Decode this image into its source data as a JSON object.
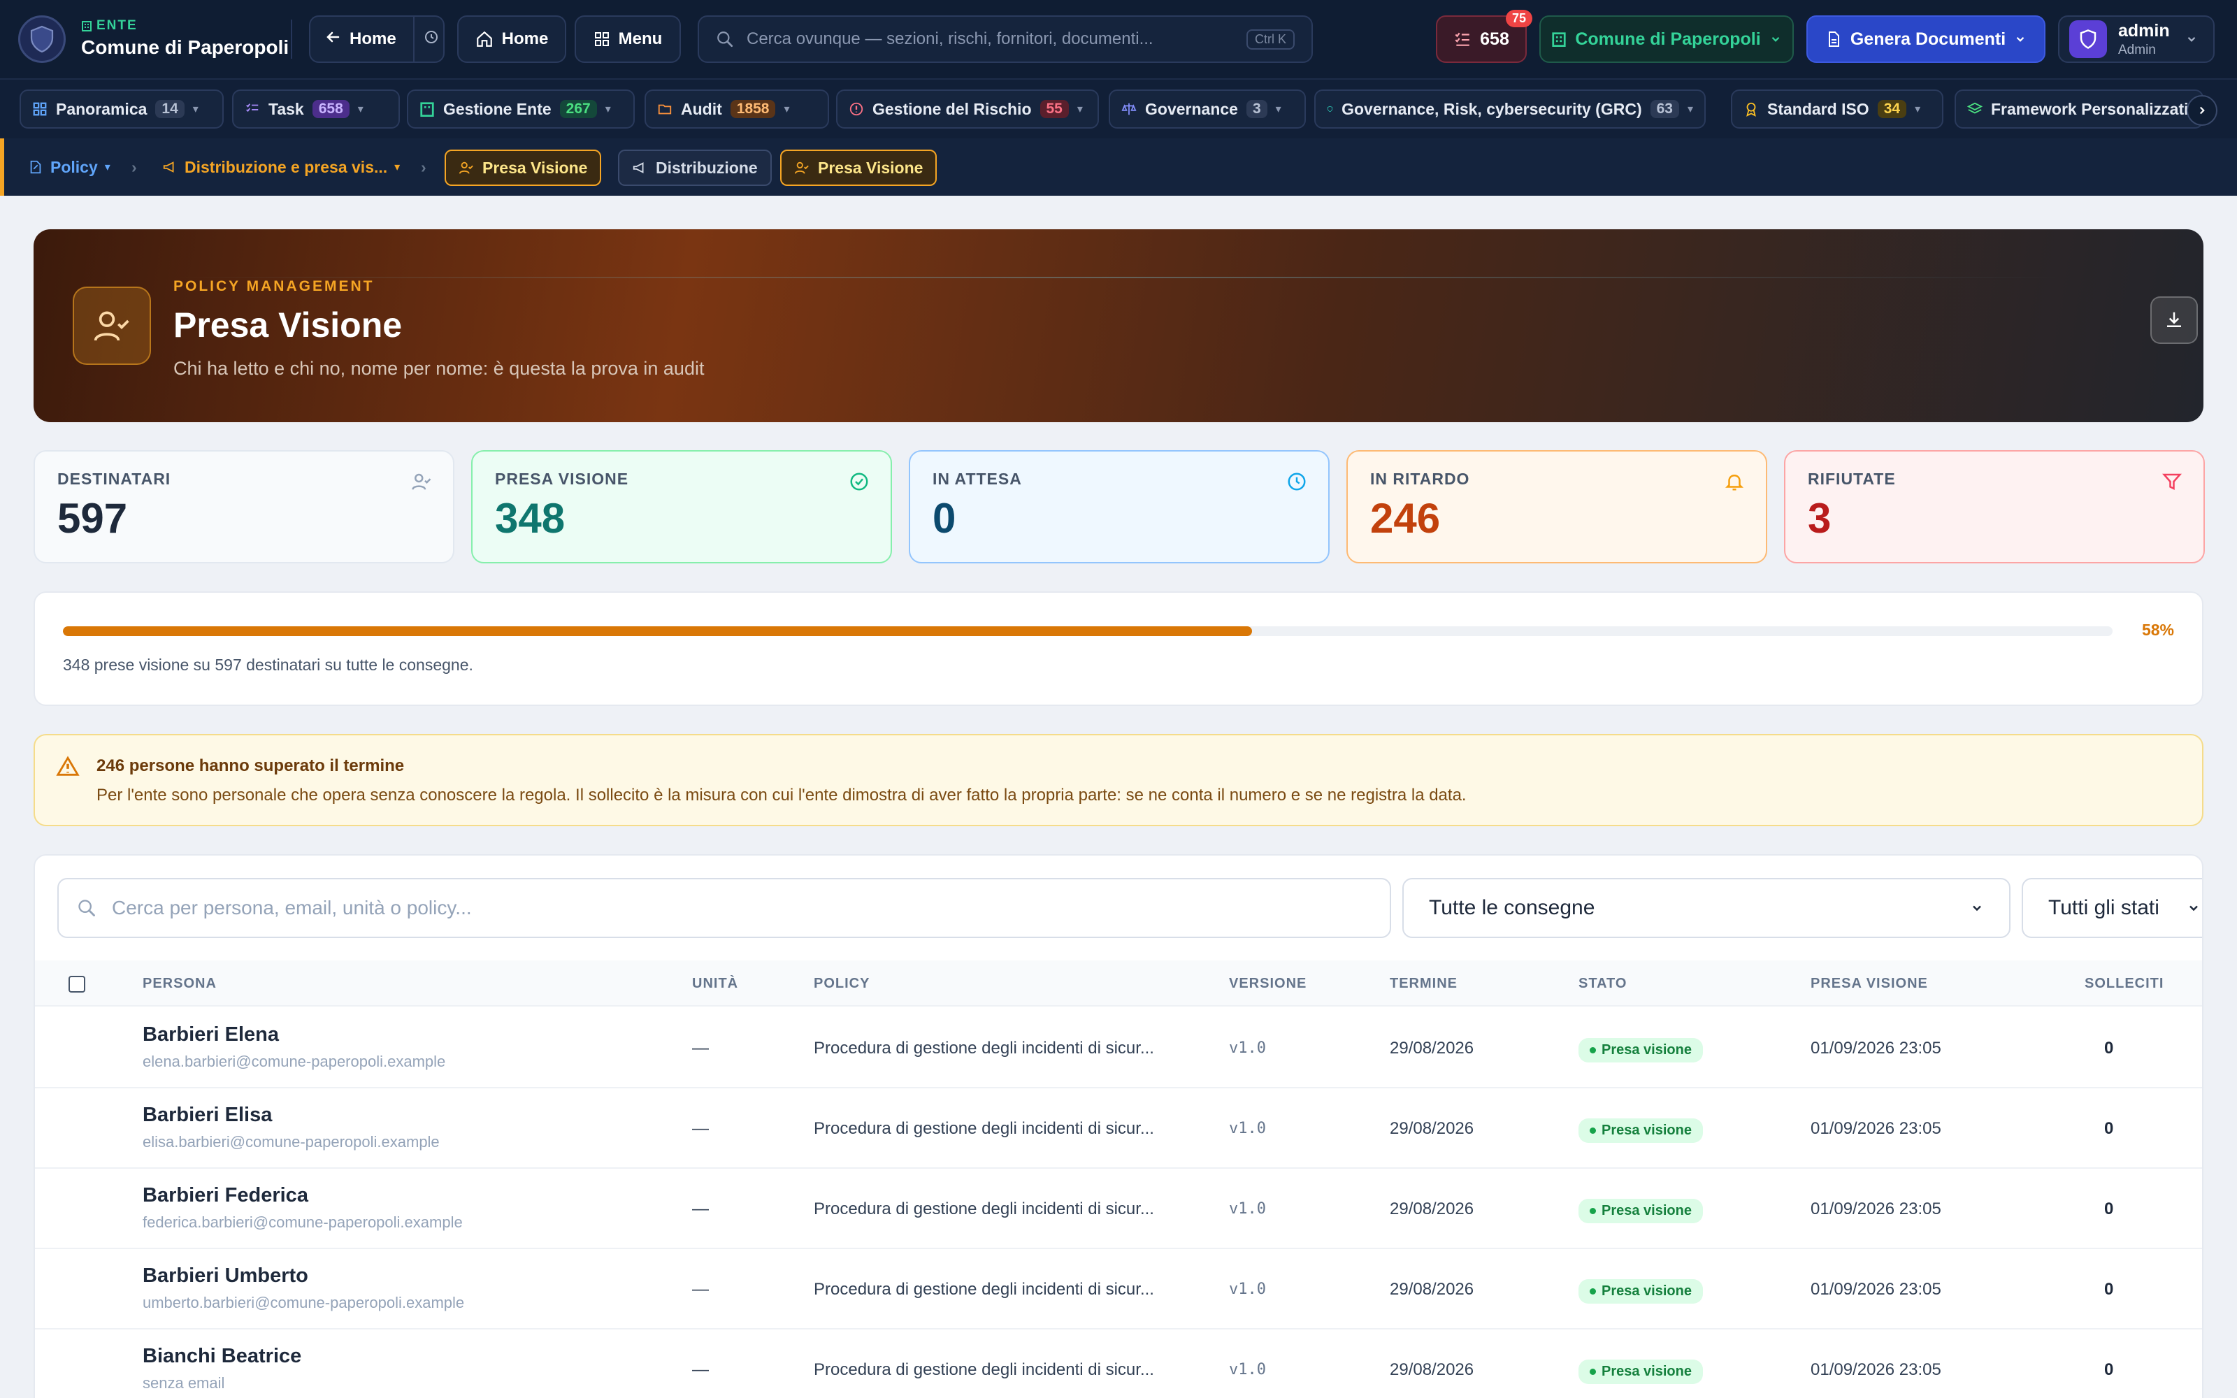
{
  "header": {
    "ente_tag": "ENTE",
    "ente_name": "Comune di Paperopoli",
    "back_label": "Home",
    "home_label": "Home",
    "menu_label": "Menu",
    "search_placeholder": "Cerca ovunque — sezioni, rischi, fornitori, documenti...",
    "search_shortcut": "Ctrl K",
    "tasks_count": "658",
    "notifications_count": "75",
    "org_label": "Comune di Paperopoli",
    "generate_label": "Genera Documenti",
    "user_name": "admin",
    "user_role": "Admin"
  },
  "modules": [
    {
      "label": "Panoramica",
      "count": "14",
      "icon": "grid-icon"
    },
    {
      "label": "Task",
      "count": "658",
      "icon": "checklist-icon"
    },
    {
      "label": "Gestione Ente",
      "count": "267",
      "icon": "building-icon"
    },
    {
      "label": "Audit",
      "count": "1858",
      "icon": "folder-icon"
    },
    {
      "label": "Gestione del Rischio",
      "count": "55",
      "icon": "alert-circle-icon"
    },
    {
      "label": "Governance",
      "count": "3",
      "icon": "scale-icon"
    },
    {
      "label": "Governance, Risk, cybersecurity (GRC)",
      "count": "63",
      "icon": "shield-icon"
    },
    {
      "label": "Standard ISO",
      "count": "34",
      "icon": "award-icon"
    },
    {
      "label": "Framework Personalizzati",
      "count": "",
      "icon": "layers-icon"
    }
  ],
  "breadcrumb": {
    "root": "Policy",
    "section": "Distribuzione e presa vis...",
    "current": "Presa Visione",
    "tabs": [
      "Distribuzione",
      "Presa Visione"
    ]
  },
  "hero": {
    "kicker": "POLICY MANAGEMENT",
    "title": "Presa Visione",
    "subtitle": "Chi ha letto e chi no, nome per nome: è questa la prova in audit"
  },
  "stats": [
    {
      "label": "DESTINATARI",
      "value": "597",
      "color": "#1e293b",
      "icon": "user-check-icon"
    },
    {
      "label": "PRESA VISIONE",
      "value": "348",
      "color": "#0f766e",
      "icon": "check-circle-icon"
    },
    {
      "label": "IN ATTESA",
      "value": "0",
      "color": "#0c4a6e",
      "icon": "clock-icon"
    },
    {
      "label": "IN RITARDO",
      "value": "246",
      "color": "#c2410c",
      "icon": "bell-icon"
    },
    {
      "label": "RIFIUTATE",
      "value": "3",
      "color": "#b91c1c",
      "icon": "filter-icon"
    }
  ],
  "progress": {
    "fraction": 0.58,
    "percent_label": "58%",
    "caption": "348 prese visione su 597 destinatari su tutte le consegne."
  },
  "warning": {
    "title": "246 persone hanno superato il termine",
    "text": "Per l'ente sono personale che opera senza conoscere la regola. Il sollecito è la misura con cui l'ente dimostra di aver fatto la propria parte: se ne conta il numero e se ne registra la data."
  },
  "filters": {
    "search_placeholder": "Cerca per persona, email, unità o policy...",
    "delivery_select": "Tutte le consegne",
    "status_select": "Tutti gli stati"
  },
  "table": {
    "columns": [
      "PERSONA",
      "UNITÀ",
      "POLICY",
      "VERSIONE",
      "TERMINE",
      "STATO",
      "PRESA VISIONE",
      "SOLLECITI"
    ],
    "rows": [
      {
        "name": "Barbieri Elena",
        "email": "elena.barbieri@comune-paperopoli.example",
        "unit": "—",
        "policy": "Procedura di gestione degli incidenti di sicur...",
        "version": "v1.0",
        "deadline": "29/08/2026",
        "status": "Presa visione",
        "seen_at": "01/09/2026 23:05",
        "reminders": "0"
      },
      {
        "name": "Barbieri Elisa",
        "email": "elisa.barbieri@comune-paperopoli.example",
        "unit": "—",
        "policy": "Procedura di gestione degli incidenti di sicur...",
        "version": "v1.0",
        "deadline": "29/08/2026",
        "status": "Presa visione",
        "seen_at": "01/09/2026 23:05",
        "reminders": "0"
      },
      {
        "name": "Barbieri Federica",
        "email": "federica.barbieri@comune-paperopoli.example",
        "unit": "—",
        "policy": "Procedura di gestione degli incidenti di sicur...",
        "version": "v1.0",
        "deadline": "29/08/2026",
        "status": "Presa visione",
        "seen_at": "01/09/2026 23:05",
        "reminders": "0"
      },
      {
        "name": "Barbieri Umberto",
        "email": "umberto.barbieri@comune-paperopoli.example",
        "unit": "—",
        "policy": "Procedura di gestione degli incidenti di sicur...",
        "version": "v1.0",
        "deadline": "29/08/2026",
        "status": "Presa visione",
        "seen_at": "01/09/2026 23:05",
        "reminders": "0"
      },
      {
        "name": "Bianchi Beatrice",
        "email": "senza email",
        "unit": "—",
        "policy": "Procedura di gestione degli incidenti di sicur...",
        "version": "v1.0",
        "deadline": "29/08/2026",
        "status": "Presa visione",
        "seen_at": "01/09/2026 23:05",
        "reminders": "0"
      }
    ]
  }
}
